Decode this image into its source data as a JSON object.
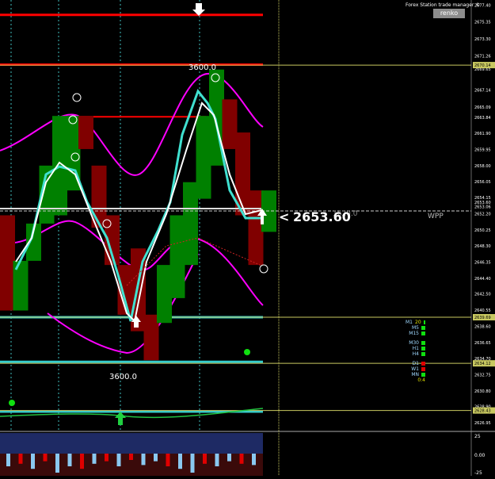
{
  "colors": {
    "background": "#000000",
    "bull_brick": "#008000",
    "bear_brick": "#800000",
    "price_label": "#ffffff",
    "level_red": "#ff0000",
    "level_cyan": "#33cccc",
    "level_yellow": "#c8c860",
    "envelope": "#ff00ff",
    "renko_line": "#40e0d0"
  },
  "header": {
    "manager_title": "Forex Station trade manager ©",
    "renko_button": "renko"
  },
  "annotations": {
    "current_price": "2653.60",
    "current_price_arrow": "<",
    "top_count": "3600.0",
    "bottom_count": "3600.0",
    "level_label": "1620.0",
    "wpp": "WPP"
  },
  "timeframes": [
    {
      "label": "M1",
      "status": "green",
      "extra": "20"
    },
    {
      "label": "M5",
      "status": "green"
    },
    {
      "label": "M15",
      "status": "green"
    },
    {
      "label": "M30",
      "status": "green"
    },
    {
      "label": "H1",
      "status": "green"
    },
    {
      "label": "H4",
      "status": "green"
    },
    {
      "label": "D1",
      "status": "red"
    },
    {
      "label": "W1",
      "status": "red"
    },
    {
      "label": "MN",
      "status": "green"
    },
    {
      "label": "",
      "status": "none",
      "extra": "0:4"
    }
  ],
  "chart_data": {
    "type": "renko",
    "y_ticks": [
      "2677.40",
      "2675.35",
      "2673.30",
      "2671.26",
      "2669.65",
      "2667.14",
      "2665.09",
      "2663.84",
      "2661.90",
      "2659.95",
      "2658.00",
      "2656.05",
      "2654.15",
      "2653.60",
      "2653.06",
      "2652.20",
      "2650.25",
      "2648.30",
      "2646.35",
      "2644.40",
      "2642.50",
      "2640.55",
      "2638.60",
      "2636.65",
      "2634.70",
      "2634.12",
      "2632.75",
      "2630.80",
      "2628.90",
      "2628.43",
      "2626.95"
    ],
    "ylim": [
      2625.9,
      2678.0
    ],
    "highlight_ticks": [
      {
        "value": "2670.14",
        "color": "#c8c860"
      },
      {
        "value": "2639.69",
        "color": "#c8c860"
      },
      {
        "value": "2634.12",
        "color": "#c8c860"
      },
      {
        "value": "2628.43",
        "color": "#c8c860"
      }
    ],
    "bricks": [
      {
        "dir": "down",
        "open": 2652.0,
        "close": 2640.5
      },
      {
        "dir": "up",
        "open": 2640.5,
        "close": 2646.5
      },
      {
        "dir": "up",
        "open": 2646.5,
        "close": 2651.0
      },
      {
        "dir": "up",
        "open": 2651.0,
        "close": 2658.0
      },
      {
        "dir": "up",
        "open": 2652.0,
        "close": 2664.0
      },
      {
        "dir": "up",
        "open": 2655.0,
        "close": 2664.0
      },
      {
        "dir": "down",
        "open": 2664.0,
        "close": 2660.0
      },
      {
        "dir": "down",
        "open": 2658.0,
        "close": 2650.5
      },
      {
        "dir": "down",
        "open": 2652.0,
        "close": 2646.0
      },
      {
        "dir": "down",
        "open": 2646.0,
        "close": 2640.0
      },
      {
        "dir": "down",
        "open": 2648.0,
        "close": 2638.0
      },
      {
        "dir": "down",
        "open": 2640.0,
        "close": 2634.5
      },
      {
        "dir": "up",
        "open": 2639.0,
        "close": 2646.0
      },
      {
        "dir": "up",
        "open": 2642.0,
        "close": 2652.0
      },
      {
        "dir": "up",
        "open": 2646.0,
        "close": 2656.0
      },
      {
        "dir": "up",
        "open": 2654.0,
        "close": 2664.0
      },
      {
        "dir": "up",
        "open": 2658.0,
        "close": 2669.6
      },
      {
        "dir": "down",
        "open": 2666.0,
        "close": 2660.0
      },
      {
        "dir": "down",
        "open": 2662.0,
        "close": 2652.0
      },
      {
        "dir": "down",
        "open": 2655.0,
        "close": 2646.0
      },
      {
        "dir": "up",
        "open": 2650.0,
        "close": 2655.0
      }
    ],
    "levels": [
      {
        "value": 2676.2,
        "color": "#ff0000"
      },
      {
        "value": 2670.2,
        "color": "#ff0000"
      },
      {
        "value": 2639.69,
        "color": "#33cccc"
      },
      {
        "value": 2634.3,
        "color": "#33cccc"
      },
      {
        "value": 2628.3,
        "color": "#33cccc"
      }
    ],
    "grid": false
  }
}
